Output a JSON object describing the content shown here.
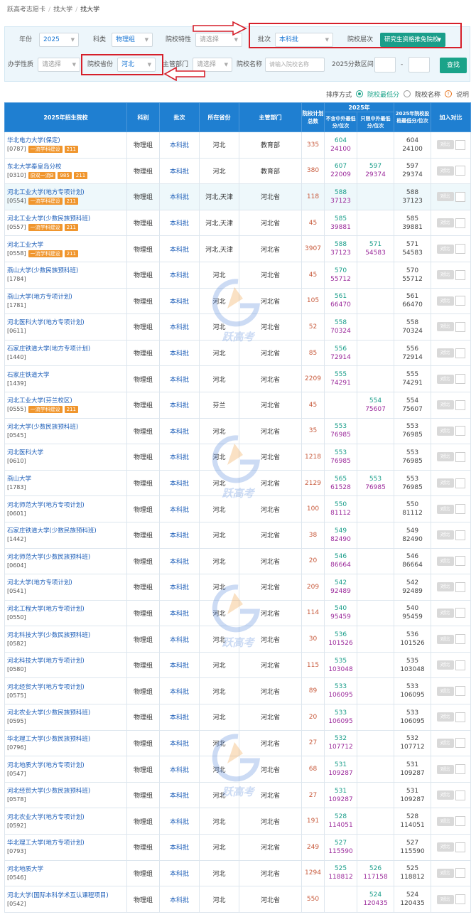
{
  "breadcrumb": [
    "跃高考志愿卡",
    "找大学",
    "找大学"
  ],
  "filters": {
    "year_label": "年份",
    "year_value": "2025",
    "subject_label": "科类",
    "subject_value": "物理组",
    "feature_label": "院校特性",
    "feature_placeholder": "请选择",
    "batch_label": "批次",
    "batch_value": "本科批",
    "level_label": "院校层次",
    "level_value": "研究生资格推免院校",
    "nature_label": "办学性质",
    "nature_placeholder": "请选择",
    "province_label": "院校省份",
    "province_value": "河北",
    "dept_label": "主管部门",
    "dept_placeholder": "请选择",
    "name_label": "院校名称",
    "name_placeholder": "请输入院校名称",
    "range_label": "2025分数区间",
    "range_sep": "-",
    "search_button": "查找"
  },
  "sort": {
    "label": "排序方式",
    "opt1": "院校最低分",
    "opt2": "院校名称",
    "help": "说明",
    "help_glyph": "!"
  },
  "table": {
    "headers": {
      "school": "2025年招生院校",
      "subject": "科别",
      "batch": "批次",
      "province": "所在省份",
      "dept": "主管部门",
      "plan": "院校计划总数",
      "year": "2025年",
      "col_a": "不含中外最低分/位次",
      "col_b": "只限中外最低分/位次",
      "min": "2025年院校投档最低分/位次",
      "compare": "加入对比"
    },
    "compare_label": "对比",
    "rows": [
      {
        "name": "华北电力大学(保定)",
        "code": "[0787]",
        "tags": [
          "一流学科建设",
          "211"
        ],
        "subject": "物理组",
        "batch": "本科批",
        "province": "河北",
        "dept": "教育部",
        "plan": "335",
        "a_score": "604",
        "a_rank": "24100",
        "b_score": "",
        "b_rank": "",
        "m_score": "604",
        "m_rank": "24100"
      },
      {
        "name": "东北大学秦皇岛分校",
        "code": "[0310]",
        "tags": [
          "原双一流B",
          "985",
          "211"
        ],
        "subject": "物理组",
        "batch": "本科批",
        "province": "河北",
        "dept": "教育部",
        "plan": "380",
        "a_score": "607",
        "a_rank": "22009",
        "b_score": "597",
        "b_rank": "29374",
        "m_score": "597",
        "m_rank": "29374"
      },
      {
        "name": "河北工业大学(地方专项计划)",
        "code": "[0554]",
        "tags": [
          "一流学科建设",
          "211"
        ],
        "subject": "物理组",
        "batch": "本科批",
        "province": "河北,天津",
        "dept": "河北省",
        "plan": "118",
        "a_score": "588",
        "a_rank": "37123",
        "b_score": "",
        "b_rank": "",
        "m_score": "588",
        "m_rank": "37123"
      },
      {
        "name": "河北工业大学(少数民族预科班)",
        "code": "[0557]",
        "tags": [
          "一流学科建设",
          "211"
        ],
        "subject": "物理组",
        "batch": "本科批",
        "province": "河北,天津",
        "dept": "河北省",
        "plan": "45",
        "a_score": "585",
        "a_rank": "39881",
        "b_score": "",
        "b_rank": "",
        "m_score": "585",
        "m_rank": "39881"
      },
      {
        "name": "河北工业大学",
        "code": "[0558]",
        "tags": [
          "一流学科建设",
          "211"
        ],
        "subject": "物理组",
        "batch": "本科批",
        "province": "河北,天津",
        "dept": "河北省",
        "plan": "3907",
        "a_score": "588",
        "a_rank": "37123",
        "b_score": "571",
        "b_rank": "54583",
        "m_score": "571",
        "m_rank": "54583"
      },
      {
        "name": "燕山大学(少数民族预科班)",
        "code": "[1784]",
        "tags": [],
        "subject": "物理组",
        "batch": "本科批",
        "province": "河北",
        "dept": "河北省",
        "plan": "45",
        "a_score": "570",
        "a_rank": "55712",
        "b_score": "",
        "b_rank": "",
        "m_score": "570",
        "m_rank": "55712"
      },
      {
        "name": "燕山大学(地方专项计划)",
        "code": "[1781]",
        "tags": [],
        "subject": "物理组",
        "batch": "本科批",
        "province": "河北",
        "dept": "河北省",
        "plan": "105",
        "a_score": "561",
        "a_rank": "66470",
        "b_score": "",
        "b_rank": "",
        "m_score": "561",
        "m_rank": "66470"
      },
      {
        "name": "河北医科大学(地方专项计划)",
        "code": "[0611]",
        "tags": [],
        "subject": "物理组",
        "batch": "本科批",
        "province": "河北",
        "dept": "河北省",
        "plan": "52",
        "a_score": "558",
        "a_rank": "70324",
        "b_score": "",
        "b_rank": "",
        "m_score": "558",
        "m_rank": "70324"
      },
      {
        "name": "石家庄铁道大学(地方专项计划)",
        "code": "[1440]",
        "tags": [],
        "subject": "物理组",
        "batch": "本科批",
        "province": "河北",
        "dept": "河北省",
        "plan": "85",
        "a_score": "556",
        "a_rank": "72914",
        "b_score": "",
        "b_rank": "",
        "m_score": "556",
        "m_rank": "72914"
      },
      {
        "name": "石家庄铁道大学",
        "code": "[1439]",
        "tags": [],
        "subject": "物理组",
        "batch": "本科批",
        "province": "河北",
        "dept": "河北省",
        "plan": "2209",
        "a_score": "555",
        "a_rank": "74291",
        "b_score": "",
        "b_rank": "",
        "m_score": "555",
        "m_rank": "74291"
      },
      {
        "name": "河北工业大学(芬兰校区)",
        "code": "[0555]",
        "tags": [
          "一流学科建设",
          "211"
        ],
        "subject": "物理组",
        "batch": "本科批",
        "province": "芬兰",
        "dept": "河北省",
        "plan": "45",
        "a_score": "",
        "a_rank": "",
        "b_score": "554",
        "b_rank": "75607",
        "m_score": "554",
        "m_rank": "75607"
      },
      {
        "name": "河北大学(少数民族预科班)",
        "code": "[0545]",
        "tags": [],
        "subject": "物理组",
        "batch": "本科批",
        "province": "河北",
        "dept": "河北省",
        "plan": "35",
        "a_score": "553",
        "a_rank": "76985",
        "b_score": "",
        "b_rank": "",
        "m_score": "553",
        "m_rank": "76985"
      },
      {
        "name": "河北医科大学",
        "code": "[0610]",
        "tags": [],
        "subject": "物理组",
        "batch": "本科批",
        "province": "河北",
        "dept": "河北省",
        "plan": "1218",
        "a_score": "553",
        "a_rank": "76985",
        "b_score": "",
        "b_rank": "",
        "m_score": "553",
        "m_rank": "76985"
      },
      {
        "name": "燕山大学",
        "code": "[1783]",
        "tags": [],
        "subject": "物理组",
        "batch": "本科批",
        "province": "河北",
        "dept": "河北省",
        "plan": "2129",
        "a_score": "565",
        "a_rank": "61528",
        "b_score": "553",
        "b_rank": "76985",
        "m_score": "553",
        "m_rank": "76985"
      },
      {
        "name": "河北师范大学(地方专项计划)",
        "code": "[0601]",
        "tags": [],
        "subject": "物理组",
        "batch": "本科批",
        "province": "河北",
        "dept": "河北省",
        "plan": "100",
        "a_score": "550",
        "a_rank": "81112",
        "b_score": "",
        "b_rank": "",
        "m_score": "550",
        "m_rank": "81112"
      },
      {
        "name": "石家庄铁道大学(少数民族预科班)",
        "code": "[1442]",
        "tags": [],
        "subject": "物理组",
        "batch": "本科批",
        "province": "河北",
        "dept": "河北省",
        "plan": "38",
        "a_score": "549",
        "a_rank": "82490",
        "b_score": "",
        "b_rank": "",
        "m_score": "549",
        "m_rank": "82490"
      },
      {
        "name": "河北师范大学(少数民族预科班)",
        "code": "[0604]",
        "tags": [],
        "subject": "物理组",
        "batch": "本科批",
        "province": "河北",
        "dept": "河北省",
        "plan": "20",
        "a_score": "546",
        "a_rank": "86664",
        "b_score": "",
        "b_rank": "",
        "m_score": "546",
        "m_rank": "86664"
      },
      {
        "name": "河北大学(地方专项计划)",
        "code": "[0541]",
        "tags": [],
        "subject": "物理组",
        "batch": "本科批",
        "province": "河北",
        "dept": "河北省",
        "plan": "209",
        "a_score": "542",
        "a_rank": "92489",
        "b_score": "",
        "b_rank": "",
        "m_score": "542",
        "m_rank": "92489"
      },
      {
        "name": "河北工程大学(地方专项计划)",
        "code": "[0550]",
        "tags": [],
        "subject": "物理组",
        "batch": "本科批",
        "province": "河北",
        "dept": "河北省",
        "plan": "114",
        "a_score": "540",
        "a_rank": "95459",
        "b_score": "",
        "b_rank": "",
        "m_score": "540",
        "m_rank": "95459"
      },
      {
        "name": "河北科技大学(少数民族预科班)",
        "code": "[0582]",
        "tags": [],
        "subject": "物理组",
        "batch": "本科批",
        "province": "河北",
        "dept": "河北省",
        "plan": "30",
        "a_score": "536",
        "a_rank": "101526",
        "b_score": "",
        "b_rank": "",
        "m_score": "536",
        "m_rank": "101526"
      },
      {
        "name": "河北科技大学(地方专项计划)",
        "code": "[0580]",
        "tags": [],
        "subject": "物理组",
        "batch": "本科批",
        "province": "河北",
        "dept": "河北省",
        "plan": "115",
        "a_score": "535",
        "a_rank": "103048",
        "b_score": "",
        "b_rank": "",
        "m_score": "535",
        "m_rank": "103048"
      },
      {
        "name": "河北经贸大学(地方专项计划)",
        "code": "[0575]",
        "tags": [],
        "subject": "物理组",
        "batch": "本科批",
        "province": "河北",
        "dept": "河北省",
        "plan": "89",
        "a_score": "533",
        "a_rank": "106095",
        "b_score": "",
        "b_rank": "",
        "m_score": "533",
        "m_rank": "106095"
      },
      {
        "name": "河北农业大学(少数民族预科班)",
        "code": "[0595]",
        "tags": [],
        "subject": "物理组",
        "batch": "本科批",
        "province": "河北",
        "dept": "河北省",
        "plan": "20",
        "a_score": "533",
        "a_rank": "106095",
        "b_score": "",
        "b_rank": "",
        "m_score": "533",
        "m_rank": "106095"
      },
      {
        "name": "华北理工大学(少数民族预科班)",
        "code": "[0796]",
        "tags": [],
        "subject": "物理组",
        "batch": "本科批",
        "province": "河北",
        "dept": "河北省",
        "plan": "27",
        "a_score": "532",
        "a_rank": "107712",
        "b_score": "",
        "b_rank": "",
        "m_score": "532",
        "m_rank": "107712"
      },
      {
        "name": "河北地质大学(地方专项计划)",
        "code": "[0547]",
        "tags": [],
        "subject": "物理组",
        "batch": "本科批",
        "province": "河北",
        "dept": "河北省",
        "plan": "68",
        "a_score": "531",
        "a_rank": "109287",
        "b_score": "",
        "b_rank": "",
        "m_score": "531",
        "m_rank": "109287"
      },
      {
        "name": "河北经贸大学(少数民族预科班)",
        "code": "[0578]",
        "tags": [],
        "subject": "物理组",
        "batch": "本科批",
        "province": "河北",
        "dept": "河北省",
        "plan": "27",
        "a_score": "531",
        "a_rank": "109287",
        "b_score": "",
        "b_rank": "",
        "m_score": "531",
        "m_rank": "109287"
      },
      {
        "name": "河北农业大学(地方专项计划)",
        "code": "[0592]",
        "tags": [],
        "subject": "物理组",
        "batch": "本科批",
        "province": "河北",
        "dept": "河北省",
        "plan": "191",
        "a_score": "528",
        "a_rank": "114051",
        "b_score": "",
        "b_rank": "",
        "m_score": "528",
        "m_rank": "114051"
      },
      {
        "name": "华北理工大学(地方专项计划)",
        "code": "[0793]",
        "tags": [],
        "subject": "物理组",
        "batch": "本科批",
        "province": "河北",
        "dept": "河北省",
        "plan": "249",
        "a_score": "527",
        "a_rank": "115590",
        "b_score": "",
        "b_rank": "",
        "m_score": "527",
        "m_rank": "115590"
      },
      {
        "name": "河北地质大学",
        "code": "[0546]",
        "tags": [],
        "subject": "物理组",
        "batch": "本科批",
        "province": "河北",
        "dept": "河北省",
        "plan": "1294",
        "a_score": "525",
        "a_rank": "118812",
        "b_score": "526",
        "b_rank": "117158",
        "m_score": "525",
        "m_rank": "118812"
      },
      {
        "name": "河北大学(国际本科学术互认课程项目)",
        "code": "[0542]",
        "tags": [],
        "subject": "物理组",
        "batch": "本科批",
        "province": "河北",
        "dept": "河北省",
        "plan": "550",
        "a_score": "",
        "a_rank": "",
        "b_score": "524",
        "b_rank": "120435",
        "m_score": "524",
        "m_rank": "120435"
      }
    ]
  },
  "watermark_text": "跃高考",
  "colors": {
    "header_blue": "#1f7fd1",
    "accent_green": "#1aa389",
    "tag_orange": "#f0962e",
    "highlight_red": "#d61f2a"
  }
}
